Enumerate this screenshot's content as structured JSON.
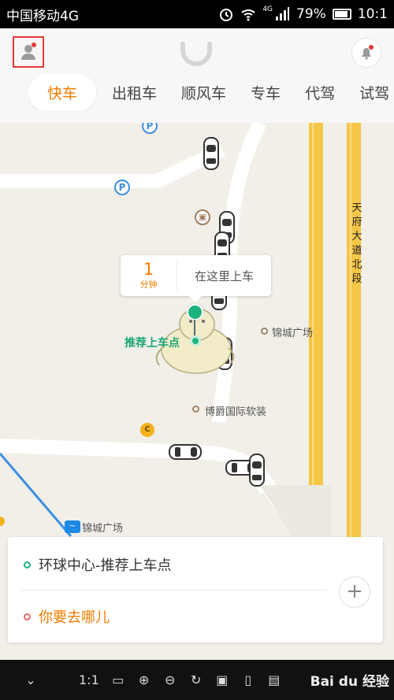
{
  "status_bar": {
    "carrier": "中国移动4G",
    "network_label": "4G",
    "battery": "79%",
    "time": "10:1"
  },
  "header": {
    "tabs": [
      {
        "label": "快车",
        "active": true
      },
      {
        "label": "出租车",
        "active": false
      },
      {
        "label": "顺风车",
        "active": false
      },
      {
        "label": "专车",
        "active": false
      },
      {
        "label": "代驾",
        "active": false
      },
      {
        "label": "试驾",
        "active": false
      }
    ]
  },
  "map": {
    "bubble": {
      "eta_value": "1",
      "eta_unit": "分钟",
      "text": "在这里上车"
    },
    "pickup_label": "推荐上车点",
    "pois": {
      "jincheng_plaza": "锦城广场",
      "bojue": "博爵国际软装",
      "metro_station": "锦城广场"
    },
    "road_name_chars": [
      "天",
      "府",
      "大",
      "道",
      "北",
      "段"
    ],
    "parking_symbol": "P",
    "c_symbol": "C"
  },
  "trip_card": {
    "from": "环球中心-推荐上车点",
    "to_placeholder": "你要去哪儿",
    "add_symbol": "+"
  },
  "viewer_toolbar": {
    "zoom_ratio": "1:1",
    "watermark": "Bai du 经验"
  },
  "colors": {
    "accent": "#f57c00",
    "pickup_green": "#1db37f",
    "highway_yellow": "#f6c646",
    "metro_blue": "#1e88e5"
  }
}
